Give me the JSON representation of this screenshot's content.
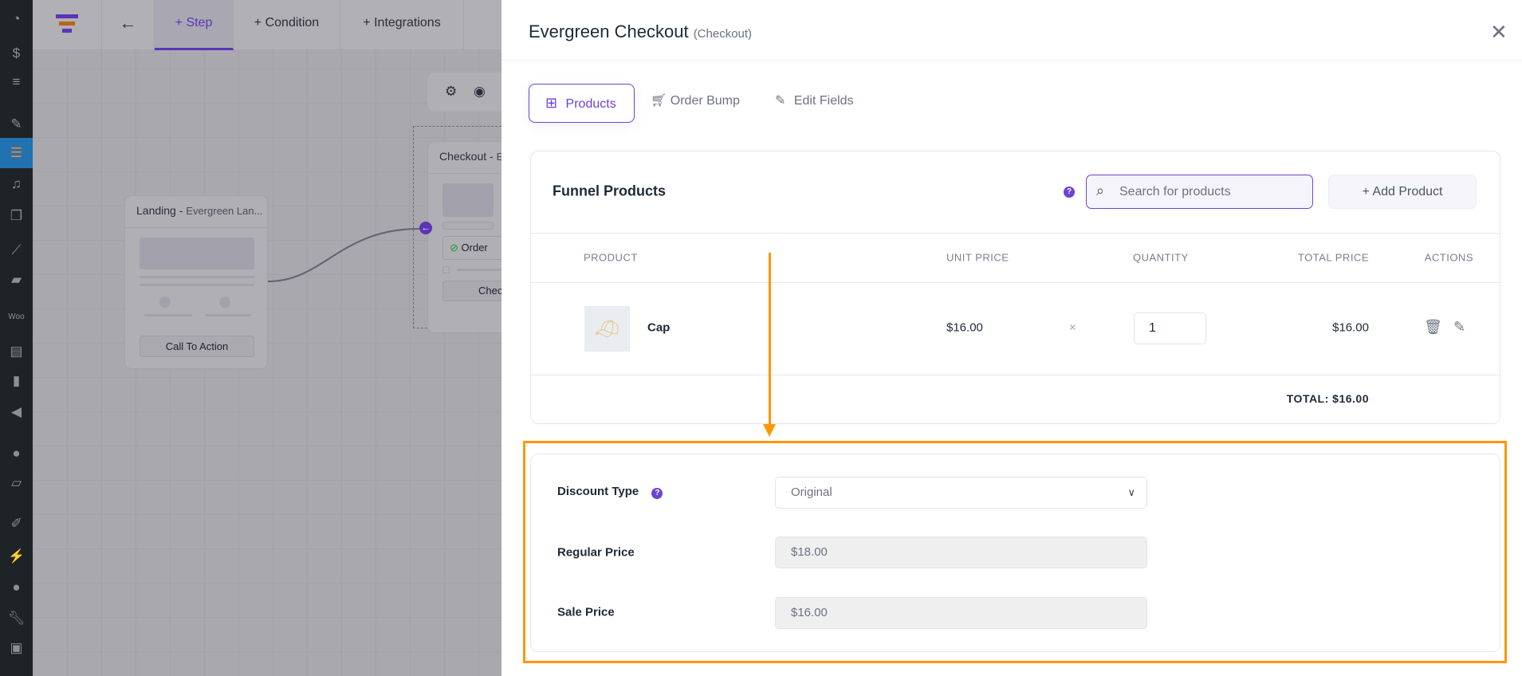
{
  "wp_sidebar": {
    "icons": [
      "dashboard-icon",
      "currency-icon",
      "stripe-icon",
      "pin-icon",
      "funnel-icon",
      "media-icon",
      "pages-icon",
      "analytics-icon",
      "comments-icon",
      "woo-icon",
      "archive-icon",
      "bar-chart-icon",
      "megaphone-icon",
      "elementor-icon",
      "folder-icon",
      "brush-icon",
      "plugin-icon",
      "user-icon",
      "wrench-icon",
      "settings-sliders-icon"
    ]
  },
  "topbar": {
    "tabs": [
      {
        "label": "Step"
      },
      {
        "label": "Condition"
      },
      {
        "label": "Integrations"
      }
    ]
  },
  "canvas": {
    "landing": {
      "type": "Landing",
      "name": "Evergreen Lan...",
      "button": "Call To Action"
    },
    "checkout": {
      "type": "Checkout",
      "name": "Eve",
      "order_label": "Order",
      "button": "Chec"
    }
  },
  "panel": {
    "title": "Evergreen Checkout",
    "subtitle": "(Checkout)",
    "tabs": [
      {
        "label": "Products",
        "icon": "grid-icon",
        "active": true
      },
      {
        "label": "Order Bump",
        "icon": "cart-icon"
      },
      {
        "label": "Edit Fields",
        "icon": "pencil-icon"
      }
    ],
    "products": {
      "title": "Funnel Products",
      "search_placeholder": "Search for products",
      "add_label": "Add Product",
      "columns": [
        "PRODUCT",
        "UNIT PRICE",
        "QUANTITY",
        "TOTAL PRICE",
        "ACTIONS"
      ],
      "rows": [
        {
          "name": "Cap",
          "unit_price": "$16.00",
          "times": "×",
          "quantity": "1",
          "total": "$16.00"
        }
      ],
      "total": "TOTAL: $16.00"
    },
    "discount": {
      "type_label": "Discount Type",
      "type_value": "Original",
      "regular_label": "Regular Price",
      "regular_value": "$18.00",
      "sale_label": "Sale Price",
      "sale_value": "$16.00"
    }
  },
  "colors": {
    "accent": "#6e42d3",
    "highlight": "#ff9800",
    "wp_active": "#2271b1"
  }
}
